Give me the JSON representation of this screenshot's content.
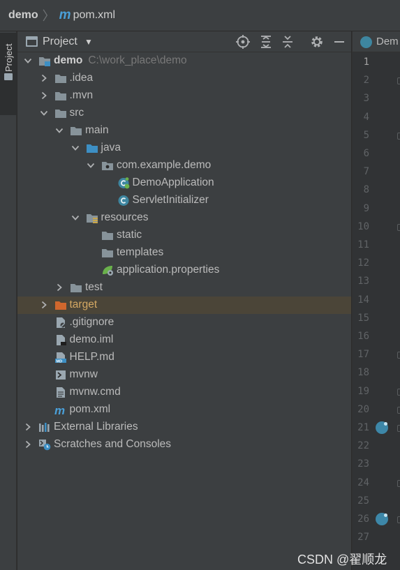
{
  "breadcrumb": {
    "root": "demo",
    "module_glyph": "m",
    "file": "pom.xml"
  },
  "side_strip": {
    "tab_label": "Project"
  },
  "panel": {
    "title": "Project"
  },
  "tree": [
    {
      "label": "demo",
      "path": "C:\\work_place\\demo",
      "depth": 0,
      "expand": "open",
      "icon": "module-folder-icon",
      "bold": true
    },
    {
      "label": ".idea",
      "depth": 1,
      "expand": "closed",
      "icon": "folder-icon"
    },
    {
      "label": ".mvn",
      "depth": 1,
      "expand": "closed",
      "icon": "folder-icon"
    },
    {
      "label": "src",
      "depth": 1,
      "expand": "open",
      "icon": "folder-icon"
    },
    {
      "label": "main",
      "depth": 2,
      "expand": "open",
      "icon": "folder-icon"
    },
    {
      "label": "java",
      "depth": 3,
      "expand": "open",
      "icon": "source-folder-icon"
    },
    {
      "label": "com.example.demo",
      "depth": 4,
      "expand": "open",
      "icon": "package-icon"
    },
    {
      "label": "DemoApplication",
      "depth": 5,
      "expand": "none",
      "icon": "spring-boot-class-icon"
    },
    {
      "label": "ServletInitializer",
      "depth": 5,
      "expand": "none",
      "icon": "class-icon"
    },
    {
      "label": "resources",
      "depth": 3,
      "expand": "open",
      "icon": "resources-folder-icon"
    },
    {
      "label": "static",
      "depth": 4,
      "expand": "none",
      "icon": "folder-icon"
    },
    {
      "label": "templates",
      "depth": 4,
      "expand": "none",
      "icon": "folder-icon"
    },
    {
      "label": "application.properties",
      "depth": 4,
      "expand": "none",
      "icon": "spring-properties-icon"
    },
    {
      "label": "test",
      "depth": 2,
      "expand": "closed",
      "icon": "folder-icon"
    },
    {
      "label": "target",
      "depth": 1,
      "expand": "closed",
      "icon": "excluded-folder-icon",
      "selected": true,
      "orange": true
    },
    {
      "label": ".gitignore",
      "depth": 1,
      "expand": "none",
      "icon": "gitignore-file-icon"
    },
    {
      "label": "demo.iml",
      "depth": 1,
      "expand": "none",
      "icon": "iml-file-icon"
    },
    {
      "label": "HELP.md",
      "depth": 1,
      "expand": "none",
      "icon": "markdown-file-icon"
    },
    {
      "label": "mvnw",
      "depth": 1,
      "expand": "none",
      "icon": "shell-script-icon"
    },
    {
      "label": "mvnw.cmd",
      "depth": 1,
      "expand": "none",
      "icon": "text-file-icon"
    },
    {
      "label": "pom.xml",
      "depth": 1,
      "expand": "none",
      "icon": "maven-pom-icon"
    },
    {
      "label": "External Libraries",
      "depth": 0,
      "expand": "closed",
      "icon": "external-libraries-icon"
    },
    {
      "label": "Scratches and Consoles",
      "depth": 0,
      "expand": "closed",
      "icon": "scratches-icon"
    }
  ],
  "editor": {
    "tab_label": "Dem",
    "line_numbers": [
      "1",
      "2",
      "3",
      "4",
      "5",
      "6",
      "7",
      "8",
      "9",
      "10",
      "11",
      "12",
      "13",
      "14",
      "15",
      "16",
      "17",
      "18",
      "19",
      "20",
      "21",
      "22",
      "23",
      "24",
      "25",
      "26",
      "27"
    ],
    "current_line": 1,
    "run_gutter_lines": [
      21,
      26
    ],
    "fold_lines": [
      2,
      5,
      10,
      17,
      19,
      20,
      21,
      24,
      26
    ]
  },
  "watermark": "CSDN @翟顺龙"
}
